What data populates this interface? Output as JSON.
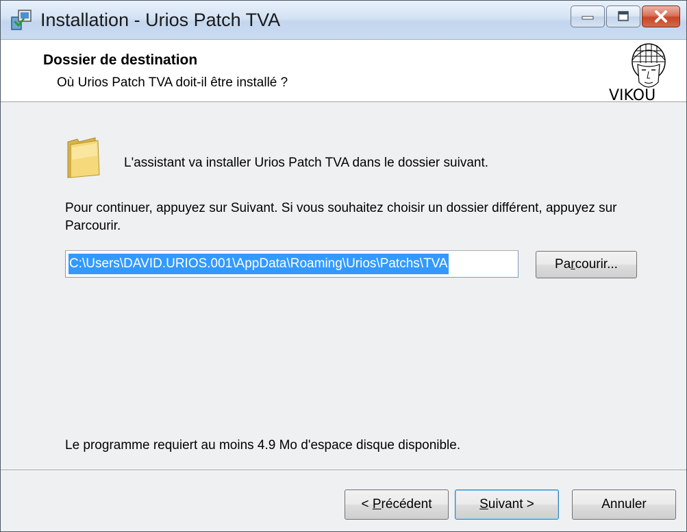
{
  "window": {
    "title": "Installation - Urios Patch TVA",
    "icon": "installer-icon"
  },
  "header": {
    "title": "Dossier de destination",
    "subtitle": "Où Urios Patch TVA doit-il être installé ?",
    "logo": "helmet-logo",
    "logo_text": "VIKOU"
  },
  "content": {
    "folder_icon": "folder-icon",
    "intro": "L'assistant va installer Urios Patch TVA dans le dossier suivant.",
    "instruction": "Pour continuer, appuyez sur Suivant. Si vous souhaitez choisir un dossier différent, appuyez sur Parcourir.",
    "path_value": "C:\\Users\\DAVID.URIOS.001\\AppData\\Roaming\\Urios\\Patchs\\TVA",
    "browse": {
      "pre": "Pa",
      "accel": "r",
      "post": "courir..."
    },
    "disk_space": "Le programme requiert au moins 4.9 Mo d'espace disque disponible."
  },
  "buttons": {
    "back": {
      "pre": "< ",
      "accel": "P",
      "post": "récédent"
    },
    "next": {
      "pre": "",
      "accel": "S",
      "post": "uivant >"
    },
    "cancel": "Annuler"
  },
  "colors": {
    "selection": "#3399ff",
    "close_button": "#c8452a",
    "titlebar": "#cadcf1"
  }
}
